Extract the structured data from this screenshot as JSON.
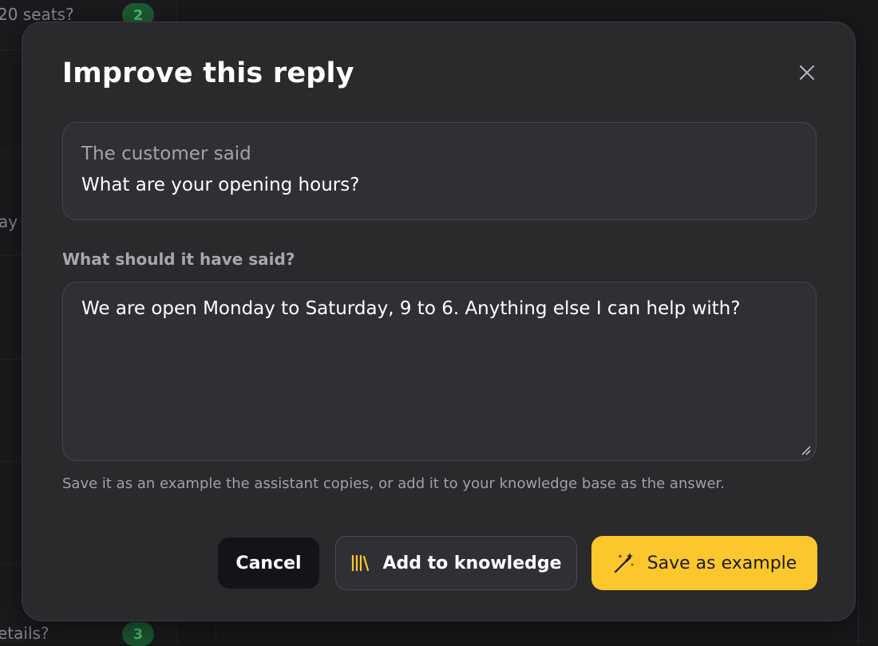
{
  "background": {
    "row1_text": "20 seats?",
    "row1_badge": "2",
    "row2_text": "ay",
    "row3_text": "etails?",
    "row3_badge": "3"
  },
  "modal": {
    "title": "Improve this reply",
    "close_icon": "close-icon",
    "customer_label": "The customer said",
    "customer_message": "What are your opening hours?",
    "field_label": "What should it have said?",
    "answer_value": "We are open Monday to Saturday, 9 to 6. Anything else I can help with?",
    "helper_text": "Save it as an example the assistant copies, or add it to your knowledge base as the answer.",
    "buttons": {
      "cancel": "Cancel",
      "add_knowledge": "Add to knowledge",
      "add_knowledge_icon": "library-icon",
      "save_example": "Save as example",
      "save_example_icon": "magic-wand-icon"
    }
  },
  "colors": {
    "accent": "#fcc72c",
    "modal_bg": "#2a2a2d",
    "badge_green": "#46c26b"
  }
}
